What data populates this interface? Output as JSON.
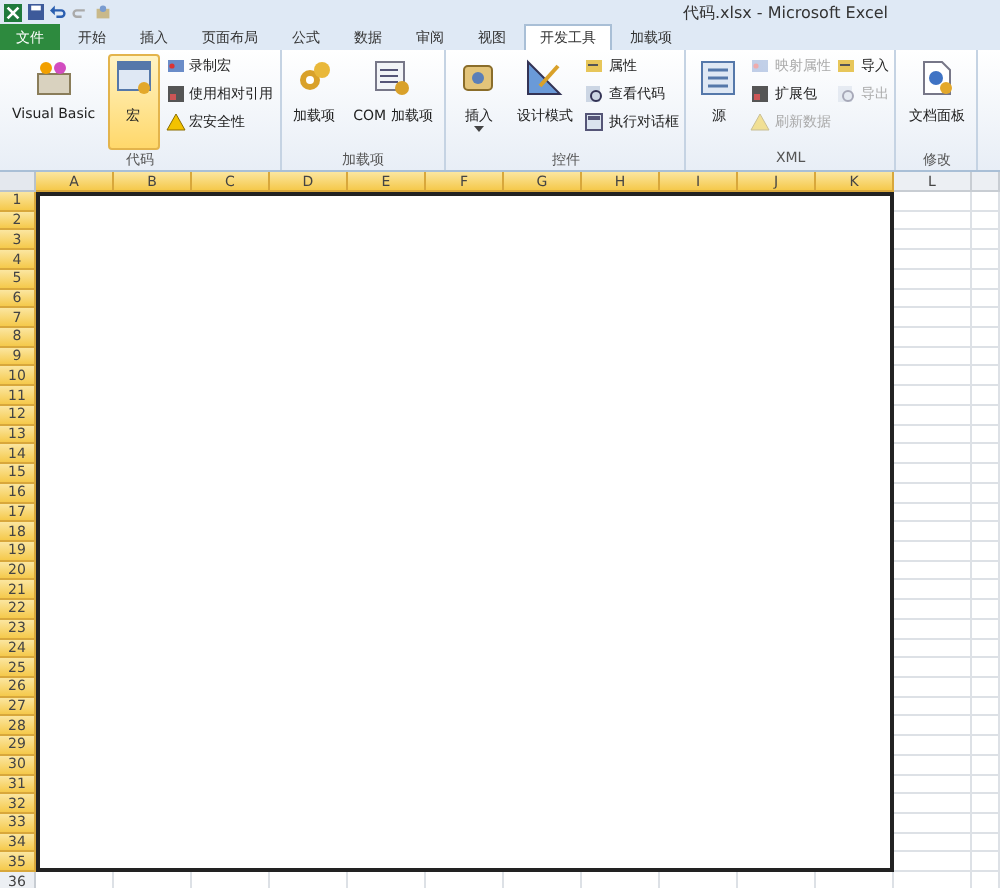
{
  "window": {
    "title": "代码.xlsx  -  Microsoft Excel"
  },
  "tabs": [
    {
      "label": "文件",
      "kind": "file",
      "selected": false
    },
    {
      "label": "开始",
      "kind": "tab",
      "selected": false
    },
    {
      "label": "插入",
      "kind": "tab",
      "selected": false
    },
    {
      "label": "页面布局",
      "kind": "tab",
      "selected": false
    },
    {
      "label": "公式",
      "kind": "tab",
      "selected": false
    },
    {
      "label": "数据",
      "kind": "tab",
      "selected": false
    },
    {
      "label": "审阅",
      "kind": "tab",
      "selected": false
    },
    {
      "label": "视图",
      "kind": "tab",
      "selected": false
    },
    {
      "label": "开发工具",
      "kind": "tab",
      "selected": true
    },
    {
      "label": "加载项",
      "kind": "tab",
      "selected": false
    }
  ],
  "ribbon": {
    "groups": [
      {
        "label": "代码",
        "columns": [
          [
            {
              "kind": "large",
              "label": "Visual Basic",
              "selected": false,
              "menu": false,
              "disabled": false
            }
          ],
          [
            {
              "kind": "large",
              "label": "宏",
              "selected": true,
              "menu": false,
              "disabled": false
            }
          ],
          [
            {
              "kind": "small",
              "label": "录制宏",
              "disabled": false
            },
            {
              "kind": "small",
              "label": "使用相对引用",
              "disabled": false
            },
            {
              "kind": "small",
              "label": "宏安全性",
              "disabled": false
            }
          ]
        ]
      },
      {
        "label": "加载项",
        "columns": [
          [
            {
              "kind": "large",
              "label": "加载项",
              "selected": false,
              "menu": false,
              "disabled": false
            }
          ],
          [
            {
              "kind": "large",
              "label": "COM 加载项",
              "selected": false,
              "menu": false,
              "disabled": false
            }
          ]
        ]
      },
      {
        "label": "控件",
        "columns": [
          [
            {
              "kind": "large",
              "label": "插入",
              "selected": false,
              "menu": true,
              "disabled": false
            }
          ],
          [
            {
              "kind": "large",
              "label": "设计模式",
              "selected": false,
              "menu": false,
              "disabled": false
            }
          ],
          [
            {
              "kind": "small",
              "label": "属性",
              "disabled": false
            },
            {
              "kind": "small",
              "label": "查看代码",
              "disabled": false
            },
            {
              "kind": "small",
              "label": "执行对话框",
              "disabled": false
            }
          ]
        ]
      },
      {
        "label": "XML",
        "columns": [
          [
            {
              "kind": "large",
              "label": "源",
              "selected": false,
              "menu": false,
              "disabled": false
            }
          ],
          [
            {
              "kind": "small",
              "label": "映射属性",
              "disabled": true
            },
            {
              "kind": "small",
              "label": "扩展包",
              "disabled": false
            },
            {
              "kind": "small",
              "label": "刷新数据",
              "disabled": true
            }
          ],
          [
            {
              "kind": "small",
              "label": "导入",
              "disabled": false
            },
            {
              "kind": "small",
              "label": "导出",
              "disabled": true
            }
          ]
        ]
      },
      {
        "label": "修改",
        "columns": [
          [
            {
              "kind": "large",
              "label": "文档面板",
              "selected": false,
              "menu": false,
              "disabled": false
            }
          ]
        ]
      }
    ]
  },
  "sheet": {
    "columns": [
      {
        "label": "A",
        "selected": true
      },
      {
        "label": "B",
        "selected": true
      },
      {
        "label": "C",
        "selected": true
      },
      {
        "label": "D",
        "selected": true
      },
      {
        "label": "E",
        "selected": true
      },
      {
        "label": "F",
        "selected": true
      },
      {
        "label": "G",
        "selected": true
      },
      {
        "label": "H",
        "selected": true
      },
      {
        "label": "I",
        "selected": true
      },
      {
        "label": "J",
        "selected": true
      },
      {
        "label": "K",
        "selected": true
      },
      {
        "label": "L",
        "selected": false
      }
    ],
    "rows": [
      {
        "label": "1",
        "selected": true
      },
      {
        "label": "2",
        "selected": true
      },
      {
        "label": "3",
        "selected": true
      },
      {
        "label": "4",
        "selected": true
      },
      {
        "label": "5",
        "selected": true
      },
      {
        "label": "6",
        "selected": true
      },
      {
        "label": "7",
        "selected": true
      },
      {
        "label": "8",
        "selected": true
      },
      {
        "label": "9",
        "selected": true
      },
      {
        "label": "10",
        "selected": true
      },
      {
        "label": "11",
        "selected": true
      },
      {
        "label": "12",
        "selected": true
      },
      {
        "label": "13",
        "selected": true
      },
      {
        "label": "14",
        "selected": true
      },
      {
        "label": "15",
        "selected": true
      },
      {
        "label": "16",
        "selected": true
      },
      {
        "label": "17",
        "selected": true
      },
      {
        "label": "18",
        "selected": true
      },
      {
        "label": "19",
        "selected": true
      },
      {
        "label": "20",
        "selected": true
      },
      {
        "label": "21",
        "selected": true
      },
      {
        "label": "22",
        "selected": true
      },
      {
        "label": "23",
        "selected": true
      },
      {
        "label": "24",
        "selected": true
      },
      {
        "label": "25",
        "selected": true
      },
      {
        "label": "26",
        "selected": true
      },
      {
        "label": "27",
        "selected": true
      },
      {
        "label": "28",
        "selected": true
      },
      {
        "label": "29",
        "selected": true
      },
      {
        "label": "30",
        "selected": true
      },
      {
        "label": "31",
        "selected": true
      },
      {
        "label": "32",
        "selected": true
      },
      {
        "label": "33",
        "selected": true
      },
      {
        "label": "34",
        "selected": true
      },
      {
        "label": "35",
        "selected": true
      },
      {
        "label": "36",
        "selected": false
      }
    ]
  }
}
